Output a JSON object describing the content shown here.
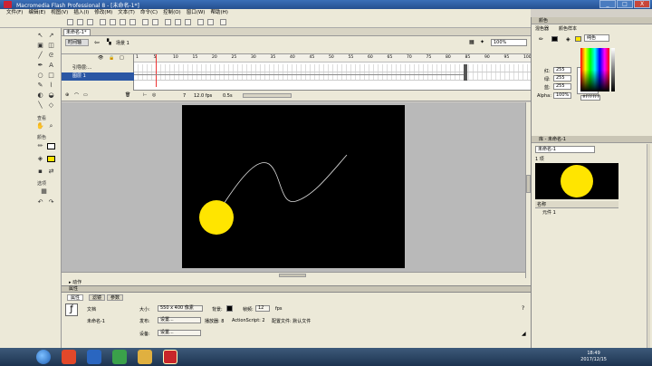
{
  "window": {
    "title": "Macromedia Flash Professional 8 - [未命名-1*]",
    "min_label": "_",
    "max_label": "□",
    "close_label": "X"
  },
  "menu": [
    "文件(F)",
    "编辑(E)",
    "视图(V)",
    "插入(I)",
    "修改(M)",
    "文本(T)",
    "命令(C)",
    "控制(O)",
    "窗口(W)",
    "帮助(H)"
  ],
  "tools": {
    "section_view": "查看",
    "section_colors": "颜色",
    "section_options": "选项"
  },
  "document": {
    "tab": "未命名-1*",
    "scene": "场景 1",
    "zoom": "100%"
  },
  "timeline": {
    "ruler": [
      "1",
      "5",
      "10",
      "15",
      "20",
      "25",
      "30",
      "35",
      "40",
      "45",
      "50",
      "55",
      "60",
      "65",
      "70",
      "75",
      "80",
      "85",
      "90",
      "95",
      "100"
    ],
    "layers": [
      {
        "name": "引导层:..."
      },
      {
        "name": "图层 1"
      }
    ],
    "current_frame": "7",
    "fps": "12.0 fps",
    "elapsed": "0.5s"
  },
  "properties": {
    "header": "属性",
    "tabs": [
      "属性",
      "滤镜",
      "参数"
    ],
    "doc_label": "文档",
    "doc_name": "未命名-1",
    "size_label": "大小:",
    "size_value": "550 x 400 像素",
    "bg_label": "背景:",
    "fps_label": "帧频:",
    "fps_value": "12",
    "fps_unit": "fps",
    "publish_label": "发布:",
    "settings_button": "设置...",
    "player_label": "播放器: 8",
    "as_label": "ActionScript: 2",
    "profile_label": "配置文件: 默认文件",
    "device_label": "设备:",
    "device_button": "设置..."
  },
  "right_panel": {
    "colors_header": "颜色",
    "color_tabs": [
      "混色器",
      "颜色样本"
    ],
    "fill_type": "纯色",
    "r_label": "红:",
    "r_value": "255",
    "g_label": "绿:",
    "g_value": "255",
    "b_label": "蓝:",
    "b_value": "255",
    "alpha_label": "Alpha:",
    "alpha_value": "100%",
    "hex_value": "#FFFFFF",
    "library_header": "库 - 未命名-1",
    "library_doc": "未命名-1",
    "library_count": "1 项",
    "library_name_col": "名称",
    "library_item": "元件 1"
  },
  "taskbar": {
    "time": "18:49",
    "date": "2017/12/15"
  },
  "colors": {
    "stage": "#000000",
    "ball": "#ffe500",
    "guide": "#ffffff"
  }
}
